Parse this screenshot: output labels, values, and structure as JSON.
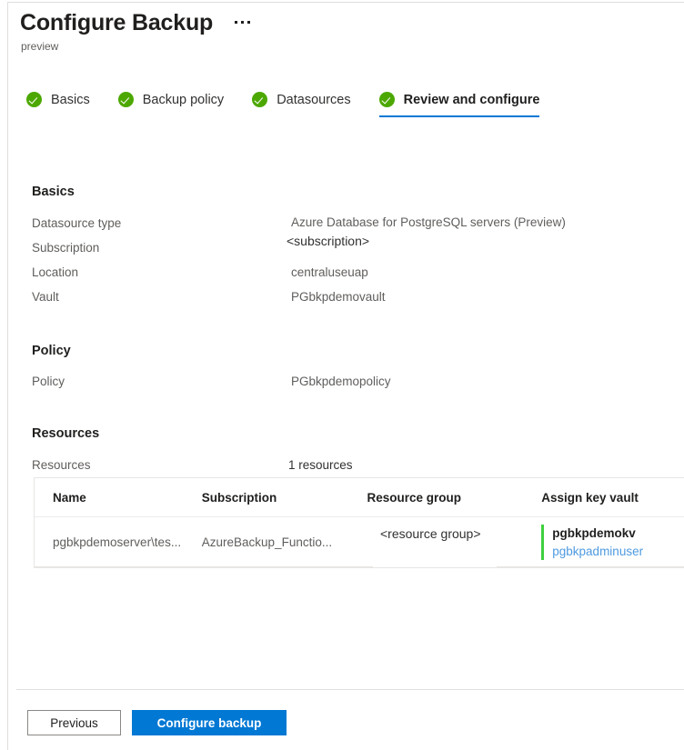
{
  "header": {
    "title": "Configure Backup",
    "preview_label": "preview",
    "more_menu": "..."
  },
  "tabs": [
    {
      "label": "Basics",
      "state": "complete",
      "active": false
    },
    {
      "label": "Backup policy",
      "state": "complete",
      "active": false
    },
    {
      "label": "Datasources",
      "state": "complete",
      "active": false
    },
    {
      "label": "Review and configure",
      "state": "complete",
      "active": true
    }
  ],
  "sections": {
    "basics": {
      "heading": "Basics",
      "rows": [
        {
          "label": "Datasource type",
          "value": "Azure Database for PostgreSQL servers (Preview)"
        },
        {
          "label": "Subscription",
          "value": "<subscription>"
        },
        {
          "label": "Location",
          "value": "centraluseuap"
        },
        {
          "label": "Vault",
          "value": "PGbkpdemovault"
        }
      ]
    },
    "policy": {
      "heading": "Policy",
      "rows": [
        {
          "label": "Policy",
          "value": "PGbkpdemopolicy"
        }
      ]
    },
    "resources": {
      "heading": "Resources",
      "summary_label": "Resources",
      "summary_value": "1 resources",
      "table": {
        "columns": [
          "Name",
          "Subscription",
          "Resource group",
          "Assign key vault"
        ],
        "rows": [
          {
            "name": "pgbkpdemoserver\\tes...",
            "subscription": "AzureBackup_Functio...",
            "resource_group": "<resource group>",
            "key_vault_name": "pgbkpdemokv",
            "key_vault_user": "pgbkpadminuser"
          }
        ]
      }
    }
  },
  "footer": {
    "previous_label": "Previous",
    "configure_label": "Configure backup"
  },
  "colors": {
    "accent": "#0078d4",
    "success": "#4ca800",
    "status_bar": "#3fd03f",
    "link": "#4e9ae0"
  }
}
